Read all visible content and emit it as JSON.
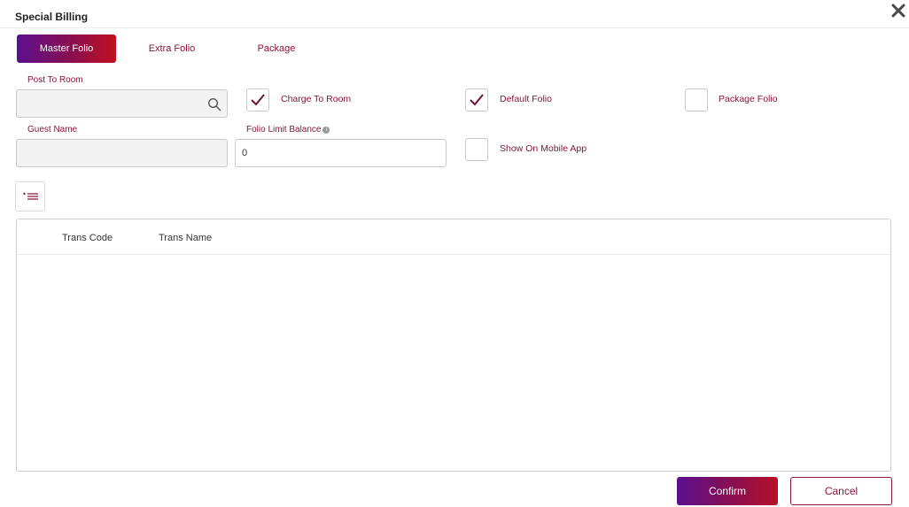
{
  "dialog": {
    "title": "Special Billing",
    "close_icon": "close-icon"
  },
  "tabs": [
    {
      "label": "Master Folio",
      "active": true
    },
    {
      "label": "Extra Folio",
      "active": false
    },
    {
      "label": "Package",
      "active": false
    }
  ],
  "form": {
    "post_to_room": {
      "label": "Post To Room",
      "value": "",
      "icon": "search-icon"
    },
    "guest_name": {
      "label": "Guest Name",
      "value": ""
    },
    "folio_limit_balance": {
      "label": "Folio Limit Balance",
      "value": "0",
      "info_icon": "info-icon"
    },
    "checkboxes": {
      "charge_to_room": {
        "label": "Charge To Room",
        "checked": true
      },
      "default_folio": {
        "label": "Default Folio",
        "checked": true
      },
      "package_folio": {
        "label": "Package Folio",
        "checked": false
      },
      "show_on_mobile_app": {
        "label": "Show On Mobile App",
        "checked": false
      }
    }
  },
  "toolbar": {
    "list_icon": "list-add-icon"
  },
  "grid": {
    "columns": [
      "Trans Code",
      "Trans Name"
    ],
    "rows": []
  },
  "footer": {
    "confirm_label": "Confirm",
    "cancel_label": "Cancel"
  },
  "colors": {
    "accent": "#8a1538",
    "gradient_start": "#5b0f8e",
    "gradient_end": "#c0101f",
    "check": "#6b1236"
  }
}
